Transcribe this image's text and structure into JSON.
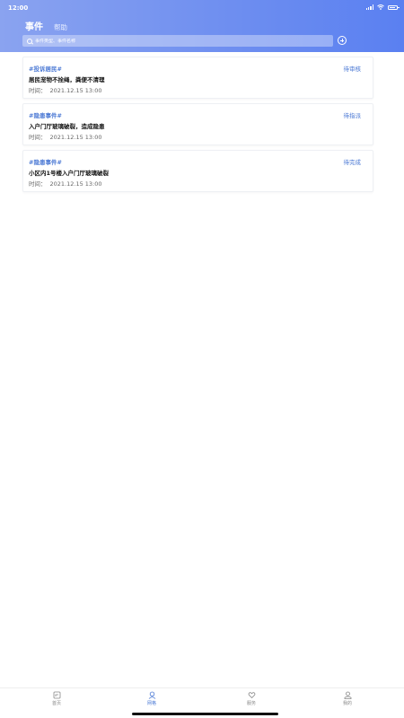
{
  "status_bar": {
    "time": "12:00"
  },
  "header": {
    "tabs": [
      {
        "label": "事件",
        "active": true
      },
      {
        "label": "帮助",
        "active": false
      }
    ],
    "search": {
      "placeholder": "事件类型、事件名称",
      "value": ""
    }
  },
  "events": [
    {
      "tag": "#投诉居民#",
      "status": "待审核",
      "title": "居民宠物不拴绳，粪便不清理",
      "time_label": "时间：",
      "time": "2021.12.15 13:00"
    },
    {
      "tag": "#隐患事件#",
      "status": "待指派",
      "title": "入户门厅玻璃破裂，造成隐患",
      "time_label": "时间：",
      "time": "2021.12.15 13:00"
    },
    {
      "tag": "#隐患事件#",
      "status": "待完成",
      "title": "小区内1号楼入户门厅玻璃破裂",
      "time_label": "时间：",
      "time": "2021.12.15 13:00"
    }
  ],
  "tabbar": [
    {
      "label": "首页",
      "icon": "home-icon",
      "active": false
    },
    {
      "label": "网格",
      "icon": "grid-user-icon",
      "active": true
    },
    {
      "label": "服务",
      "icon": "heart-hand-icon",
      "active": false
    },
    {
      "label": "我的",
      "icon": "profile-icon",
      "active": false
    }
  ],
  "colors": {
    "accent": "#4a78d4",
    "header_start": "#8aa3f0",
    "header_end": "#5a80f1"
  }
}
